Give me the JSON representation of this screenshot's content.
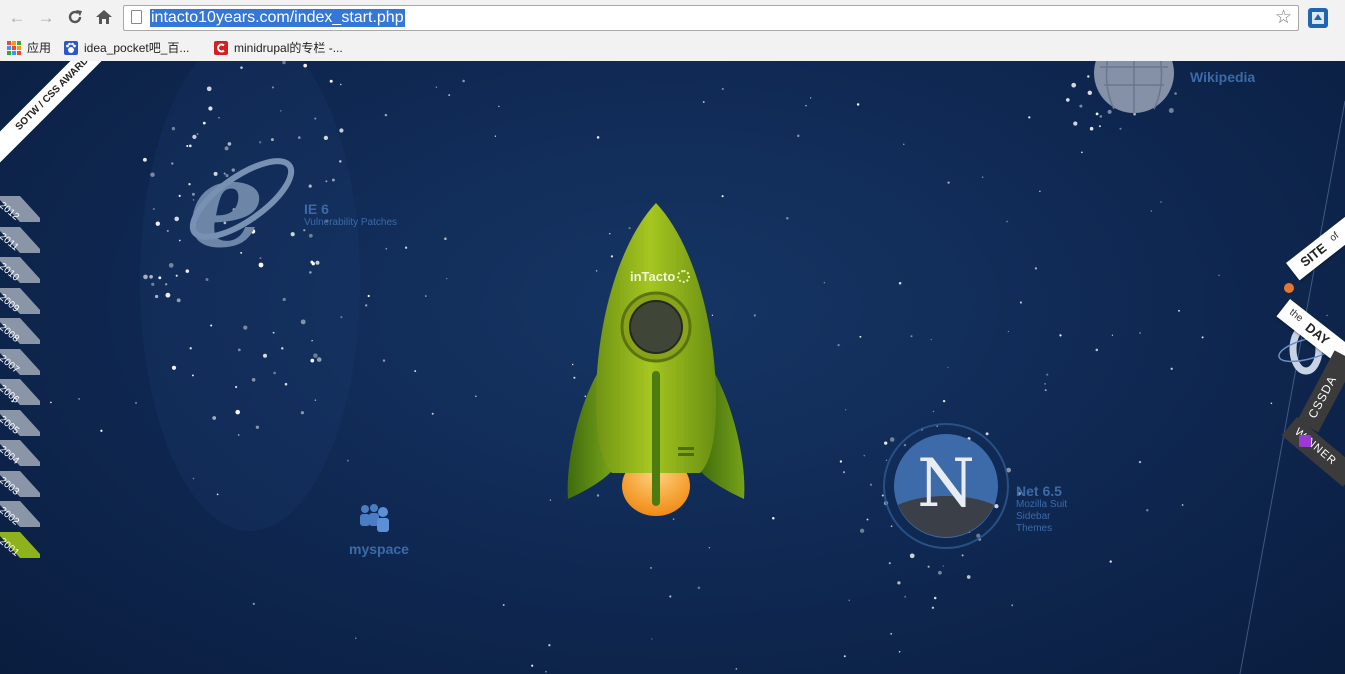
{
  "browser": {
    "url": "intacto10years.com/index_start.php",
    "nav_icons": [
      "back-icon",
      "forward-icon",
      "reload-icon",
      "home-icon"
    ],
    "bookmarks": [
      {
        "label": "应用",
        "icon": "apps-grid-icon"
      },
      {
        "label": "idea_pocket吧_百...",
        "icon": "paw-icon"
      },
      {
        "label": "minidrupal的专栏 -...",
        "icon": "csdn-c-icon"
      }
    ]
  },
  "page": {
    "ribbon_award": "SOTW / CSS AWARDS",
    "years": [
      "2012",
      "2011",
      "2010",
      "2009",
      "2008",
      "2007",
      "2006",
      "2005",
      "2004",
      "2003",
      "2002",
      "2001"
    ],
    "selected_year": "2001",
    "rocket_brand": "inTacto",
    "planets": {
      "ie": {
        "title": "IE 6",
        "subtitle": "Vulnerability Patches"
      },
      "myspace": {
        "title": "myspace"
      },
      "netscape": {
        "title": "Net 6.5",
        "lines": [
          "Mozilla Suit",
          "Sidebar",
          "Themes"
        ]
      },
      "wikipedia": {
        "title": "Wikipedia"
      }
    },
    "badges": {
      "site_of_the_day": {
        "line1": "SITE",
        "line1b": "of",
        "line2a": "the",
        "line2b": "DAY"
      },
      "cssda": {
        "line1": "CSSDA",
        "line2": "WINNER"
      }
    }
  },
  "colors": {
    "accent": "#8db21b",
    "label": "#3b6aa8",
    "space": "#102a55"
  }
}
